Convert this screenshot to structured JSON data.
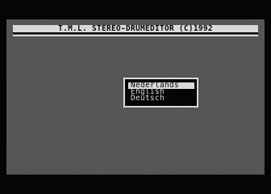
{
  "app": {
    "title": "T.M.L. STEREO-DRUMEDITOR (C)1992"
  },
  "language_menu": {
    "selected_index": 0,
    "items": [
      {
        "label": "Nederlands"
      },
      {
        "label": "English"
      },
      {
        "label": "Deutsch"
      }
    ]
  },
  "colors": {
    "background": "#050505",
    "foreground": "#d9d9d9"
  }
}
